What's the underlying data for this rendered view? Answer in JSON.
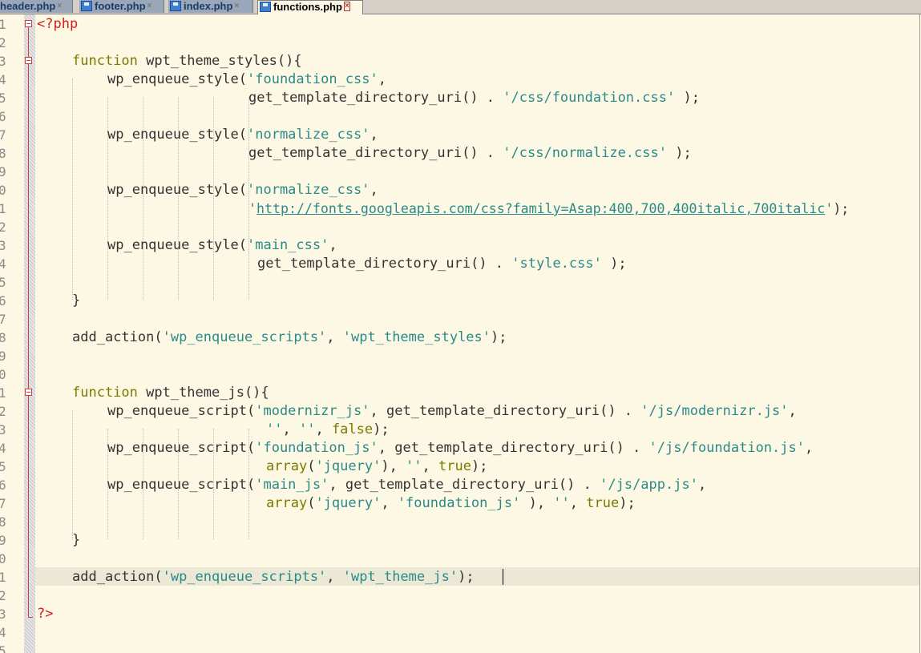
{
  "tabs": [
    {
      "label": "header.php",
      "active": false
    },
    {
      "label": "footer.php",
      "active": false
    },
    {
      "label": "index.php",
      "active": false
    },
    {
      "label": "functions.php",
      "active": true
    }
  ],
  "tab_close_glyph": "×",
  "line_numbers": [
    "1",
    "2",
    "3",
    "4",
    "5",
    "6",
    "7",
    "8",
    "9",
    "0",
    "1",
    "2",
    "3",
    "4",
    "5",
    "6",
    "7",
    "8",
    "9",
    "0",
    "1",
    "2",
    "3",
    "4",
    "5",
    "6",
    "7",
    "8",
    "9",
    "0",
    "1",
    "2",
    "3",
    "4",
    "5"
  ],
  "code": {
    "l1": {
      "open": "<?php"
    },
    "l3": {
      "kw": "function",
      "rest": " wpt_theme_styles(){"
    },
    "l4": {
      "a": "wp_enqueue_style(",
      "s1": "'foundation_css'",
      "b": ","
    },
    "l5": {
      "a": "get_template_directory_uri() . ",
      "s1": "'/css/foundation.css'",
      "b": " );"
    },
    "l7": {
      "a": "wp_enqueue_style(",
      "s1": "'normalize_css'",
      "b": ","
    },
    "l8": {
      "a": "get_template_directory_uri() . ",
      "s1": "'/css/normalize.css'",
      "b": " );"
    },
    "l10": {
      "a": "wp_enqueue_style(",
      "s1": "'normalize_css'",
      "b": ","
    },
    "l11": {
      "q1": "'",
      "url": "http://fonts.googleapis.com/css?family=Asap:400,700,400italic,700italic",
      "q2": "'",
      "b": ");"
    },
    "l13": {
      "a": "wp_enqueue_style(",
      "s1": "'main_css'",
      "b": ","
    },
    "l14": {
      "a": "get_template_directory_uri() . ",
      "s1": "'style.css'",
      "b": " );"
    },
    "l16": {
      "a": "}"
    },
    "l18": {
      "a": "add_action(",
      "s1": "'wp_enqueue_scripts'",
      "b": ", ",
      "s2": "'wpt_theme_styles'",
      "c": ");"
    },
    "l21": {
      "kw": "function",
      "rest": " wpt_theme_js(){"
    },
    "l22": {
      "a": "wp_enqueue_script(",
      "s1": "'modernizr_js'",
      "b": ", get_template_directory_uri() . ",
      "s2": "'/js/modernizr.js'",
      "c": ","
    },
    "l23": {
      "s1": "''",
      "b": ", ",
      "s2": "''",
      "c": ", ",
      "kw": "false",
      "d": ");"
    },
    "l24": {
      "a": "wp_enqueue_script(",
      "s1": "'foundation_js'",
      "b": ", get_template_directory_uri() . ",
      "s2": "'/js/foundation.js'",
      "c": ","
    },
    "l25": {
      "kw1": "array",
      "a": "(",
      "s1": "'jquery'",
      "b": "), ",
      "s2": "''",
      "c": ", ",
      "kw2": "true",
      "d": ");"
    },
    "l26": {
      "a": "wp_enqueue_script(",
      "s1": "'main_js'",
      "b": ", get_template_directory_uri() . ",
      "s2": "'/js/app.js'",
      "c": ","
    },
    "l27": {
      "kw1": "array",
      "a": "(",
      "s1": "'jquery'",
      "b": ", ",
      "s2": "'foundation_js'",
      "c": " ), ",
      "s3": "''",
      "d": ", ",
      "kw2": "true",
      "e": ");"
    },
    "l29": {
      "a": "}"
    },
    "l31": {
      "a": "add_action(",
      "s1": "'wp_enqueue_scripts'",
      "b": ", ",
      "s2": "'wpt_theme_js'",
      "c": ");"
    },
    "l33": {
      "close": "?>"
    }
  },
  "colors": {
    "keyword": "#7a7a00",
    "string": "#2a8a8a",
    "php_tag": "#d02020",
    "background": "#fdf8e4",
    "current_line": "#ebe8d6"
  },
  "current_line": 31
}
